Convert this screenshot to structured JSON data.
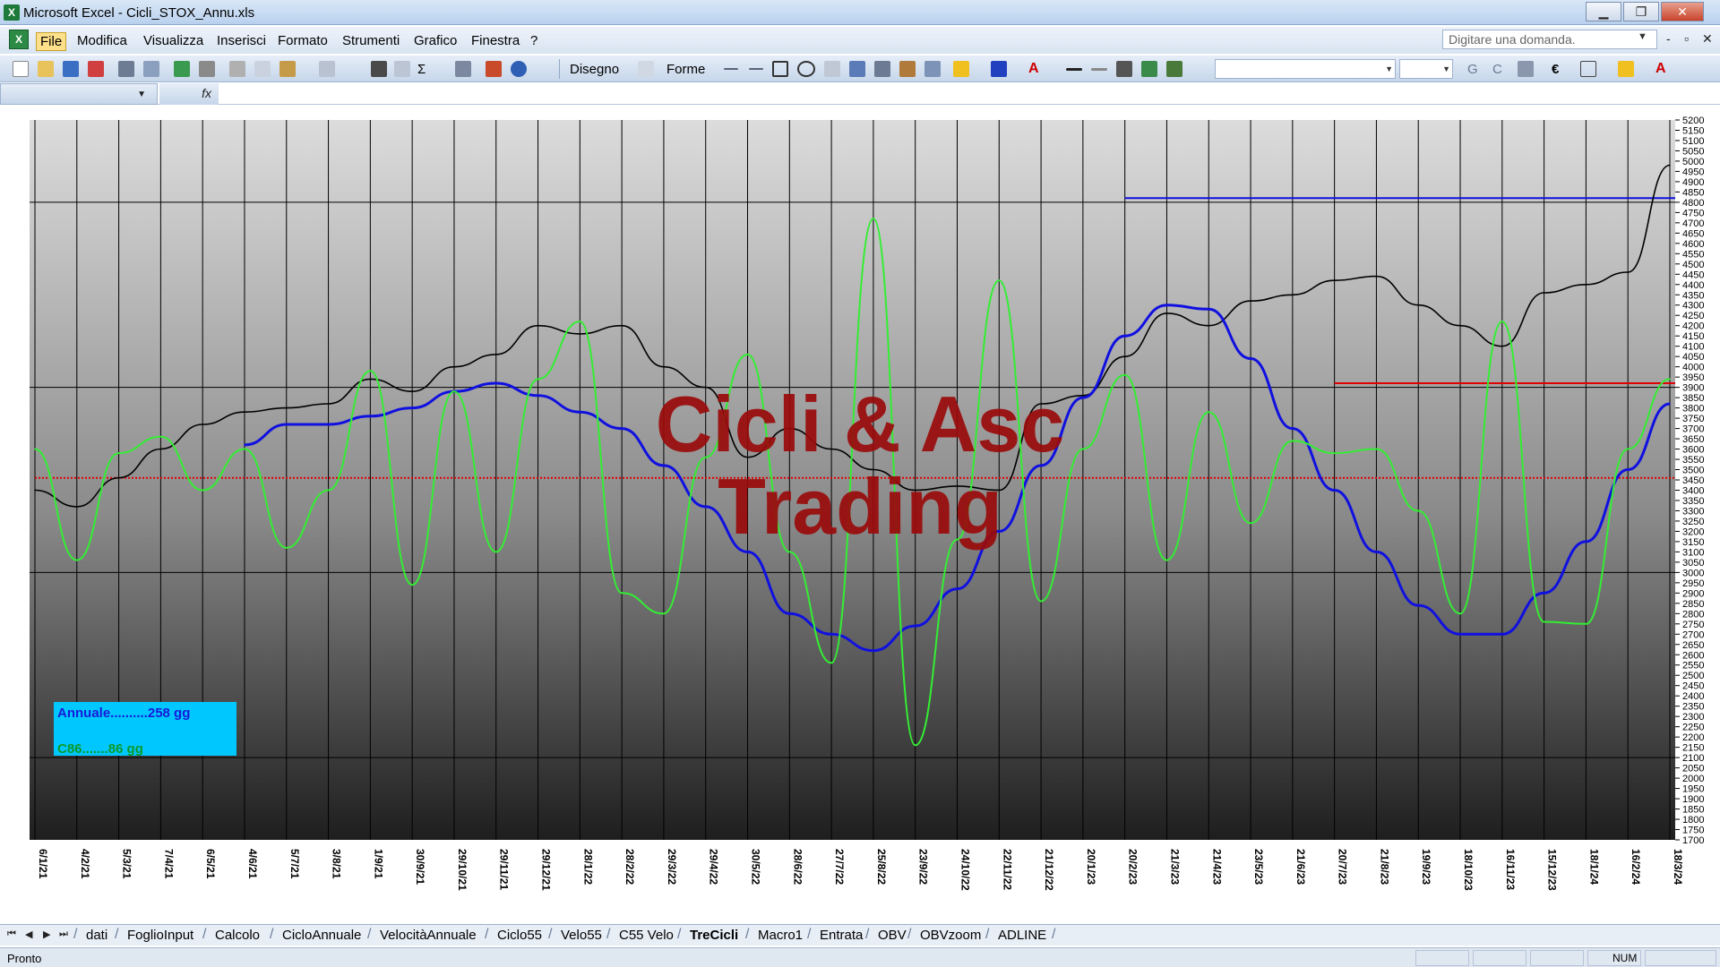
{
  "window": {
    "title": "Microsoft Excel - Cicli_STOX_Annu.xls",
    "app_icon": "X",
    "minimize": "▁",
    "maximize": "❐",
    "close": "✕"
  },
  "menu": {
    "items": [
      "File",
      "Modifica",
      "Visualizza",
      "Inserisci",
      "Formato",
      "Strumenti",
      "Grafico",
      "Finestra",
      "?"
    ],
    "active": "File",
    "help_placeholder": "Digitare una domanda.",
    "win_controls": [
      "-",
      "▫",
      "✕"
    ]
  },
  "toolbar": {
    "disegno": "Disegno",
    "forme": "Forme",
    "euro": "€",
    "bold_g": "G",
    "italic_c": "C",
    "sigma": "Σ"
  },
  "formula_bar": {
    "fx": "fx"
  },
  "legend": {
    "line1": "Annuale..........258 gg",
    "line2": "C86.......86 gg"
  },
  "watermark": {
    "line1": "Cicli & Asc",
    "line2": "Trading"
  },
  "sheet_tabs": {
    "tabs": [
      "dati",
      "FoglioInput",
      "Calcolo",
      "CicloAnnuale",
      "VelocitàAnnuale",
      "Ciclo55",
      "Velo55",
      "C55 Velo",
      "TreCicli",
      "Macro1",
      "Entrata",
      "OBV",
      "OBVzoom",
      "ADLINE"
    ],
    "active": "TreCicli",
    "nav": [
      "⏮",
      "◀",
      "▶",
      "⏭"
    ]
  },
  "status": {
    "left": "Pronto",
    "num": "NUM"
  },
  "colors": {
    "price": "#000000",
    "annual_cycle": "#1010e0",
    "c86_cycle": "#33ee33",
    "ref_line_red": "#e00000",
    "ref_line_blue": "#1010e0",
    "legend_bg": "#00c8ff"
  },
  "chart_data": {
    "type": "line",
    "y_axis": {
      "min": 1700,
      "max": 5200,
      "ticks": [
        5200,
        5150,
        5100,
        5050,
        5000,
        4950,
        4900,
        4850,
        4800,
        4750,
        4700,
        4650,
        4600,
        4550,
        4500,
        4450,
        4400,
        4350,
        4300,
        4250,
        4200,
        4150,
        4100,
        4050,
        4000,
        3950,
        3900,
        3850,
        3800,
        3750,
        3700,
        3650,
        3600,
        3550,
        3500,
        3450,
        3400,
        3350,
        3300,
        3250,
        3200,
        3150,
        3100,
        3050,
        3000,
        2950,
        2900,
        2850,
        2800,
        2750,
        2700,
        2650,
        2600,
        2550,
        2500,
        2450,
        2400,
        2350,
        2300,
        2250,
        2200,
        2150,
        2100,
        2050,
        2000,
        1950,
        1900,
        1850,
        1800,
        1750,
        1700
      ],
      "position": "right"
    },
    "x_axis": {
      "labels": [
        "6/1/21",
        "4/2/21",
        "5/3/21",
        "7/4/21",
        "6/5/21",
        "4/6/21",
        "5/7/21",
        "3/8/21",
        "1/9/21",
        "30/9/21",
        "29/10/21",
        "29/11/21",
        "29/12/21",
        "28/1/22",
        "28/2/22",
        "29/3/22",
        "29/4/22",
        "30/5/22",
        "28/6/22",
        "27/7/22",
        "25/8/22",
        "23/9/22",
        "24/10/22",
        "22/11/22",
        "21/12/22",
        "20/1/23",
        "20/2/23",
        "21/3/23",
        "21/4/23",
        "23/5/23",
        "21/6/23",
        "20/7/23",
        "21/8/23",
        "19/9/23",
        "18/10/23",
        "16/11/23",
        "15/12/23",
        "18/1/24",
        "16/2/24",
        "18/3/24"
      ],
      "label_orientation": "vertical"
    },
    "grid": true,
    "series": [
      {
        "role": "price",
        "color": "#000000",
        "values": [
          3400,
          3320,
          3460,
          3600,
          3720,
          3780,
          3800,
          3820,
          3940,
          3880,
          4000,
          4060,
          4200,
          4160,
          4200,
          4000,
          3900,
          3560,
          3700,
          3600,
          3500,
          3400,
          3420,
          3400,
          3820,
          3860,
          4050,
          4260,
          4200,
          4320,
          4350,
          4420,
          4440,
          4300,
          4200,
          4100,
          4360,
          4400,
          4460,
          4980
        ]
      },
      {
        "role": "annual_cycle",
        "color": "#1010e0",
        "values": [
          null,
          null,
          null,
          null,
          null,
          3620,
          3720,
          3720,
          3760,
          3800,
          3880,
          3920,
          3860,
          3780,
          3700,
          3520,
          3320,
          3100,
          2800,
          2700,
          2620,
          2740,
          2920,
          3200,
          3520,
          3850,
          4150,
          4300,
          4280,
          4040,
          3700,
          3400,
          3100,
          2840,
          2700,
          2700,
          2900,
          3150,
          3500,
          3820
        ]
      },
      {
        "role": "c86_cycle",
        "color": "#33ee33",
        "values": [
          3600,
          3060,
          3580,
          3660,
          3400,
          3600,
          3120,
          3400,
          3980,
          2940,
          3880,
          3100,
          3940,
          4220,
          2900,
          2800,
          3560,
          4060,
          3100,
          2560,
          4720,
          2160,
          3160,
          4420,
          2860,
          3600,
          3960,
          3060,
          3780,
          3240,
          3640,
          3580,
          3600,
          3300,
          2800,
          4220,
          2760,
          2750,
          3600,
          3940
        ]
      }
    ],
    "reference_lines": [
      {
        "y": 4820,
        "color": "#1010e0",
        "from_label": "20/2/23"
      },
      {
        "y": 3920,
        "color": "#e00000",
        "from_label": "20/7/23"
      },
      {
        "y": 3460,
        "color": "#e00000",
        "style": "dotted",
        "from_label": "6/1/21"
      }
    ]
  }
}
